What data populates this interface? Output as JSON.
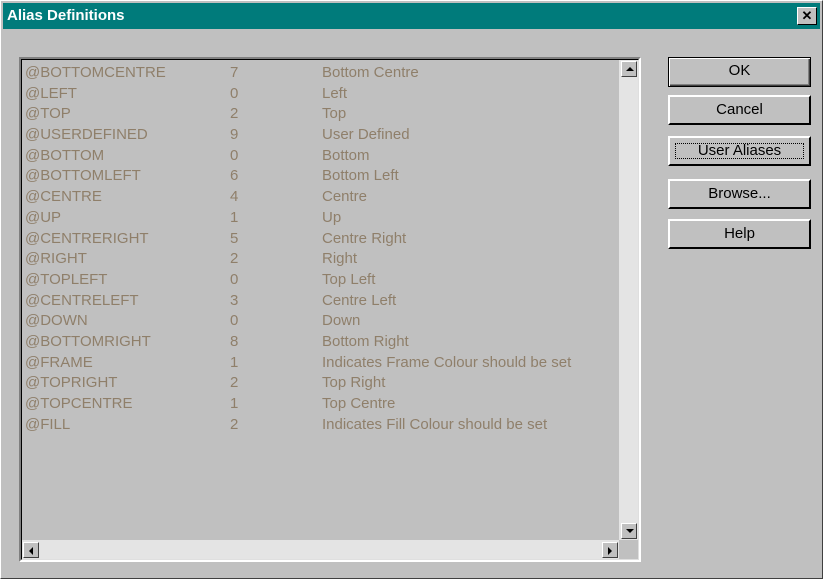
{
  "window": {
    "title": "Alias Definitions",
    "close_glyph": "✕"
  },
  "aliases": [
    {
      "name": "@BOTTOMCENTRE",
      "value": "7",
      "description": "Bottom Centre"
    },
    {
      "name": "@LEFT",
      "value": "0",
      "description": "Left"
    },
    {
      "name": "@TOP",
      "value": "2",
      "description": "Top"
    },
    {
      "name": "@USERDEFINED",
      "value": "9",
      "description": "User Defined"
    },
    {
      "name": "@BOTTOM",
      "value": "0",
      "description": "Bottom"
    },
    {
      "name": "@BOTTOMLEFT",
      "value": "6",
      "description": "Bottom Left"
    },
    {
      "name": "@CENTRE",
      "value": "4",
      "description": "Centre"
    },
    {
      "name": "@UP",
      "value": "1",
      "description": "Up"
    },
    {
      "name": "@CENTRERIGHT",
      "value": "5",
      "description": "Centre Right"
    },
    {
      "name": "@RIGHT",
      "value": "2",
      "description": "Right"
    },
    {
      "name": "@TOPLEFT",
      "value": "0",
      "description": "Top Left"
    },
    {
      "name": "@CENTRELEFT",
      "value": "3",
      "description": "Centre Left"
    },
    {
      "name": "@DOWN",
      "value": "0",
      "description": "Down"
    },
    {
      "name": "@BOTTOMRIGHT",
      "value": "8",
      "description": "Bottom Right"
    },
    {
      "name": "@FRAME",
      "value": "1",
      "description": "Indicates Frame Colour should be set"
    },
    {
      "name": "@TOPRIGHT",
      "value": "2",
      "description": "Top Right"
    },
    {
      "name": "@TOPCENTRE",
      "value": "1",
      "description": "Top Centre"
    },
    {
      "name": "@FILL",
      "value": "2",
      "description": "Indicates Fill Colour should be set"
    }
  ],
  "buttons": {
    "ok": "OK",
    "cancel": "Cancel",
    "user_aliases": "User Aliases",
    "browse": "Browse...",
    "help": "Help"
  },
  "colors": {
    "titlebar": "#007b7b",
    "face": "#c0c0c0",
    "list_text": "#8f7f6a"
  }
}
